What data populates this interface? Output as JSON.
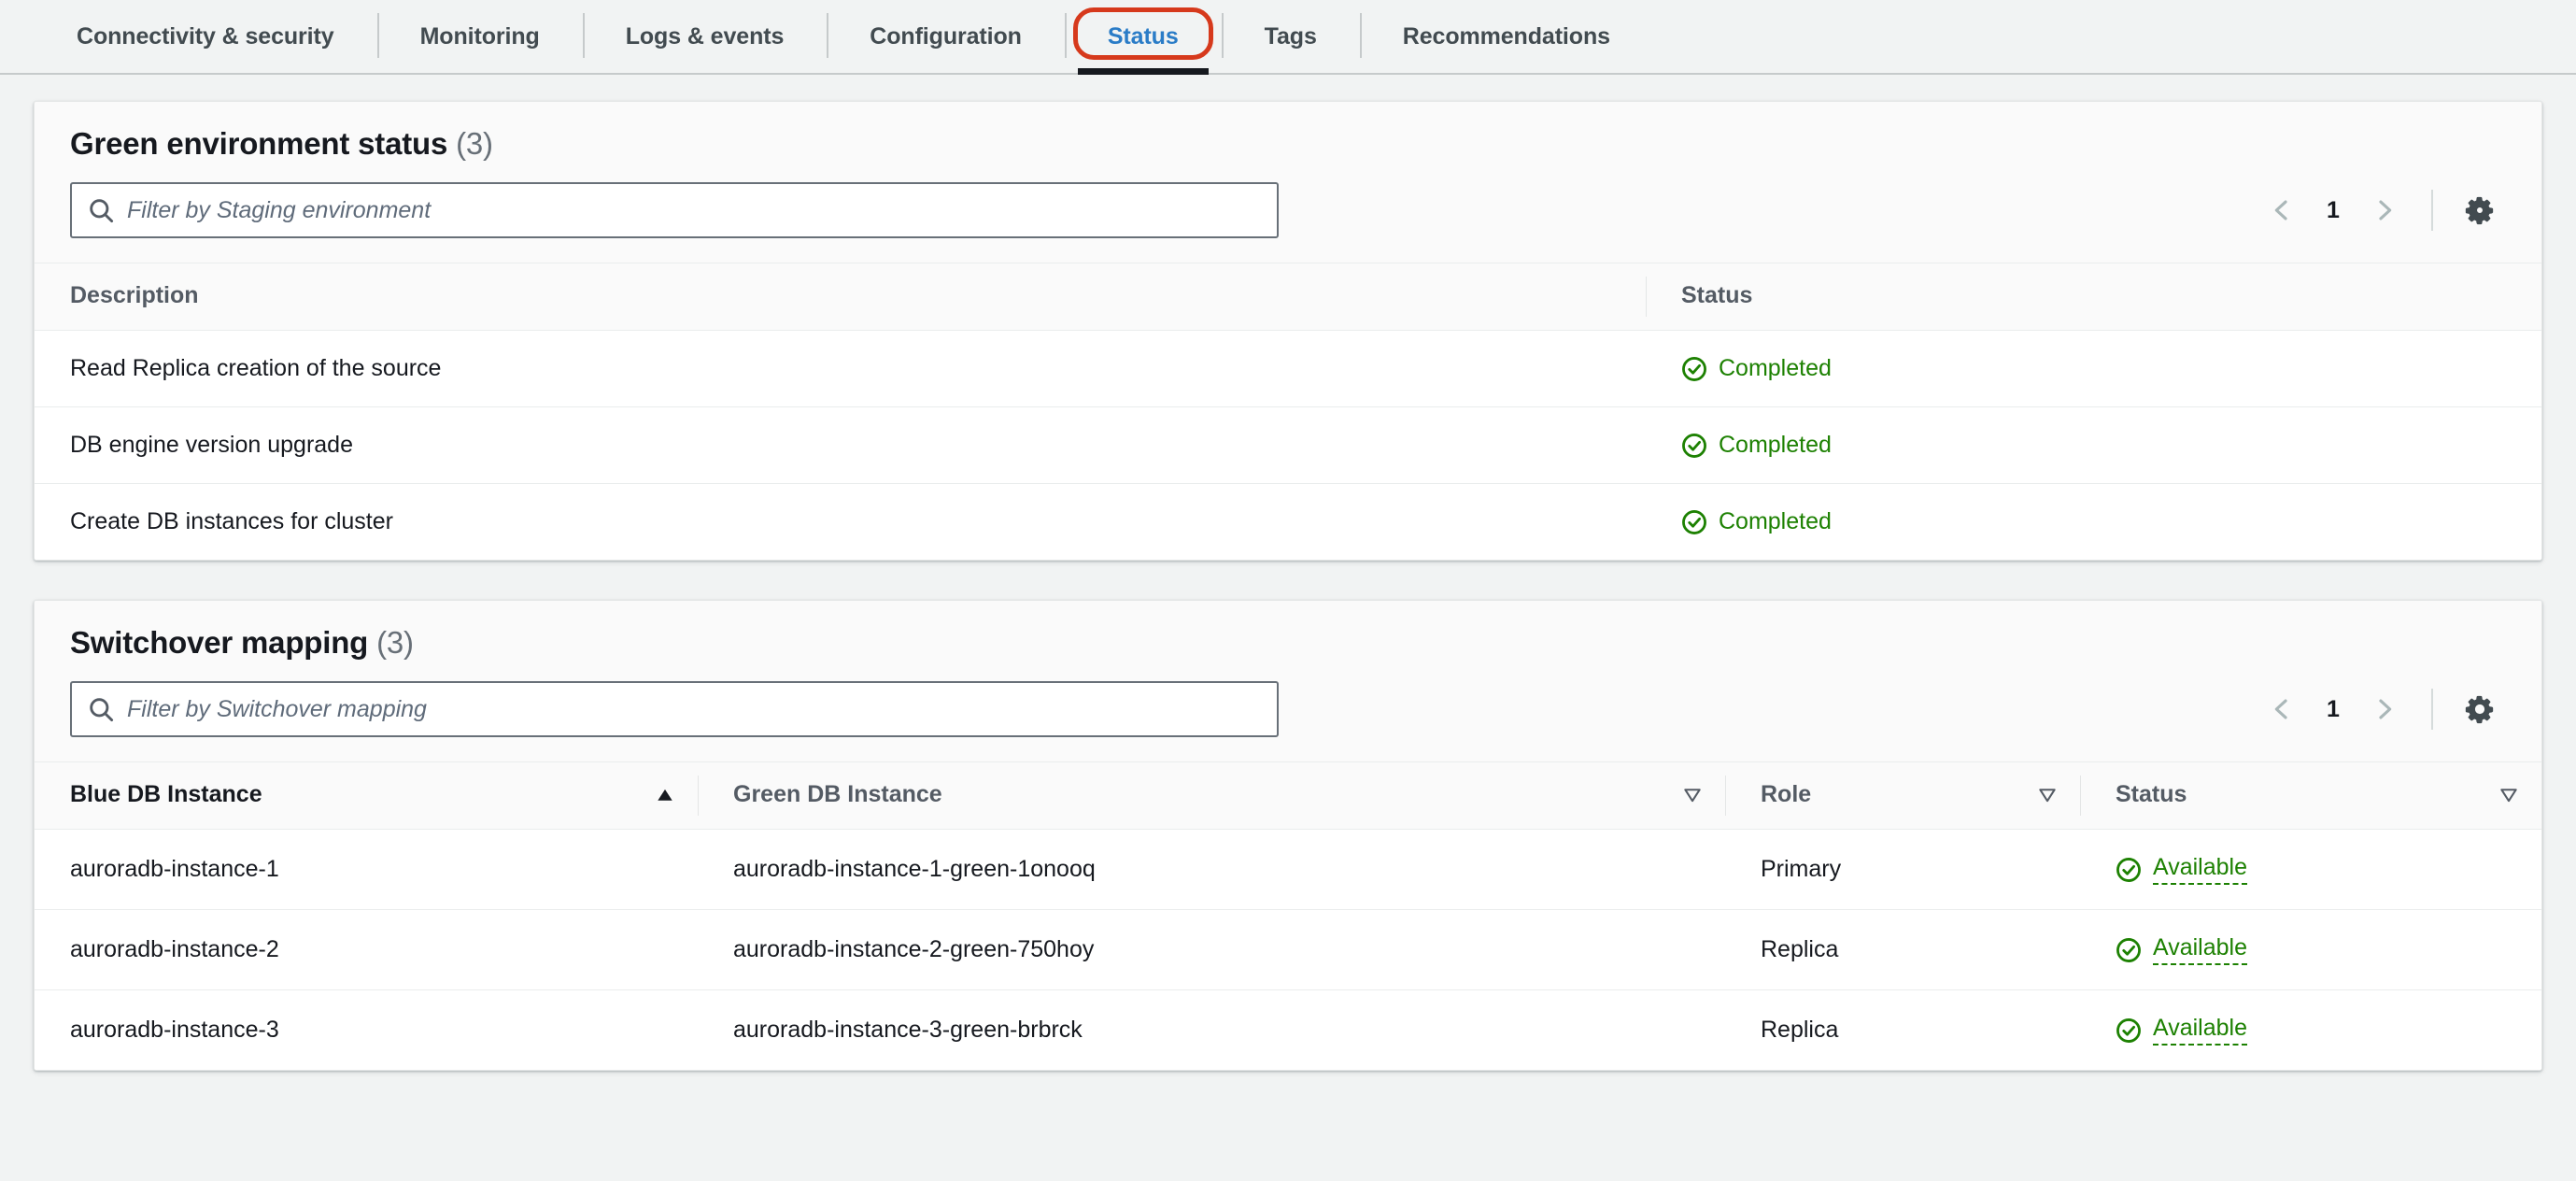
{
  "tabs": [
    {
      "label": "Connectivity & security",
      "active": false
    },
    {
      "label": "Monitoring",
      "active": false
    },
    {
      "label": "Logs & events",
      "active": false
    },
    {
      "label": "Configuration",
      "active": false
    },
    {
      "label": "Status",
      "active": true
    },
    {
      "label": "Tags",
      "active": false
    },
    {
      "label": "Recommendations",
      "active": false
    }
  ],
  "colors": {
    "accent_blue": "#2a7cc7",
    "annotation_red": "#d6391c",
    "status_green": "#1d8102",
    "active_underline": "#16191f",
    "page_bg": "#f1f3f3"
  },
  "green_environment_status": {
    "title": "Green environment status",
    "count": "(3)",
    "search_placeholder": "Filter by Staging environment",
    "search_value": "",
    "search_icon": "search-icon",
    "pagination": {
      "prev_icon": "chevron-left-icon",
      "page": "1",
      "next_icon": "chevron-right-icon"
    },
    "settings_icon": "gear-icon",
    "columns": [
      {
        "label": "Description",
        "sort": "none"
      },
      {
        "label": "Status",
        "sort": "none"
      }
    ],
    "rows": [
      {
        "description": "Read Replica creation of the source",
        "status": "Completed",
        "status_icon": "check-circle-icon"
      },
      {
        "description": "DB engine version upgrade",
        "status": "Completed",
        "status_icon": "check-circle-icon"
      },
      {
        "description": "Create DB instances for cluster",
        "status": "Completed",
        "status_icon": "check-circle-icon"
      }
    ]
  },
  "switchover_mapping": {
    "title": "Switchover mapping",
    "count": "(3)",
    "search_placeholder": "Filter by Switchover mapping",
    "search_value": "",
    "search_icon": "search-icon",
    "pagination": {
      "prev_icon": "chevron-left-icon",
      "page": "1",
      "next_icon": "chevron-right-icon"
    },
    "settings_icon": "gear-icon",
    "columns": [
      {
        "label": "Blue DB Instance",
        "sort": "asc"
      },
      {
        "label": "Green DB Instance",
        "sort": "none"
      },
      {
        "label": "Role",
        "sort": "none"
      },
      {
        "label": "Status",
        "sort": "none"
      }
    ],
    "rows": [
      {
        "blue": "auroradb-instance-1",
        "green": "auroradb-instance-1-green-1onooq",
        "role": "Primary",
        "status": "Available",
        "status_icon": "check-circle-icon"
      },
      {
        "blue": "auroradb-instance-2",
        "green": "auroradb-instance-2-green-750hoy",
        "role": "Replica",
        "status": "Available",
        "status_icon": "check-circle-icon"
      },
      {
        "blue": "auroradb-instance-3",
        "green": "auroradb-instance-3-green-brbrck",
        "role": "Replica",
        "status": "Available",
        "status_icon": "check-circle-icon"
      }
    ]
  }
}
